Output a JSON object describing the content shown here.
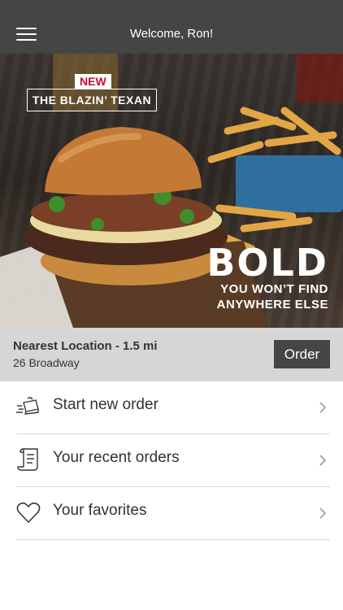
{
  "header": {
    "title": "Welcome, Ron!",
    "menu_icon": "hamburger-menu-icon"
  },
  "promo": {
    "badge": "NEW",
    "product_name": "THE BLAZIN’ TEXAN",
    "headline": "BOLD",
    "tagline_line1": "YOU WON’T FIND",
    "tagline_line2": "ANYWHERE ELSE"
  },
  "location": {
    "title": "Nearest Location - 1.5 mi",
    "address": "26 Broadway",
    "order_label": "Order"
  },
  "menu": {
    "items": [
      {
        "label": "Start new order",
        "icon": "delivery-icon"
      },
      {
        "label": "Your recent orders",
        "icon": "receipt-icon"
      },
      {
        "label": "Your favorites",
        "icon": "heart-icon"
      }
    ]
  },
  "colors": {
    "header_bg": "#454545",
    "location_bg": "#d6d6d6",
    "badge_red": "#c8102e"
  }
}
